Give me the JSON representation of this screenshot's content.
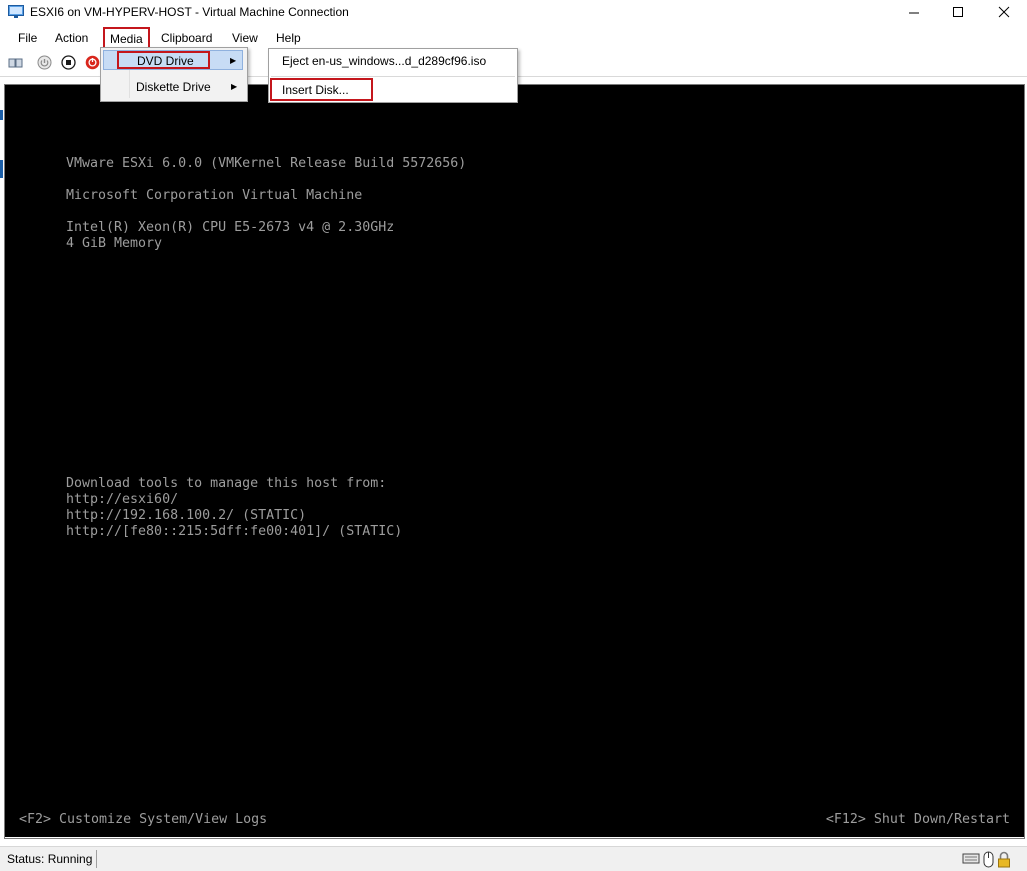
{
  "window": {
    "title": "ESXI6 on VM-HYPERV-HOST - Virtual Machine Connection",
    "min_glyph": "—",
    "max_glyph": "☐",
    "close_glyph": "✕"
  },
  "menubar": {
    "items": [
      {
        "label": "File"
      },
      {
        "label": "Action"
      },
      {
        "label": "Media"
      },
      {
        "label": "Clipboard"
      },
      {
        "label": "View"
      },
      {
        "label": "Help"
      }
    ]
  },
  "media_menu": {
    "dvd_drive": "DVD Drive",
    "diskette_drive": "Diskette Drive"
  },
  "dvd_submenu": {
    "eject": "Eject en-us_windows...d_d289cf96.iso",
    "insert": "Insert Disk..."
  },
  "console": {
    "lines": [
      "VMware ESXi 6.0.0 (VMKernel Release Build 5572656)",
      "Microsoft Corporation Virtual Machine",
      "Intel(R) Xeon(R) CPU E5-2673 v4 @ 2.30GHz",
      "4 GiB Memory",
      "Download tools to manage this host from:",
      "http://esxi60/",
      "http://192.168.100.2/ (STATIC)",
      "http://[fe80::215:5dff:fe00:401]/ (STATIC)"
    ],
    "footer_left": "<F2> Customize System/View Logs",
    "footer_right": "<F12> Shut Down/Restart"
  },
  "status": {
    "text": "Status: Running"
  },
  "icons": {
    "app": "vm-monitor-icon",
    "toolbar": [
      "ctrl-alt-del-icon",
      "power-off-icon",
      "stop-icon",
      "shutdown-icon"
    ],
    "status": [
      "keyboard-icon",
      "mouse-icon",
      "lock-icon"
    ]
  },
  "colors": {
    "highlight_frame": "#c4161c",
    "console_bg": "#000000",
    "console_text": "#9d9d9d",
    "menu_hover": "#c7dcf5"
  }
}
